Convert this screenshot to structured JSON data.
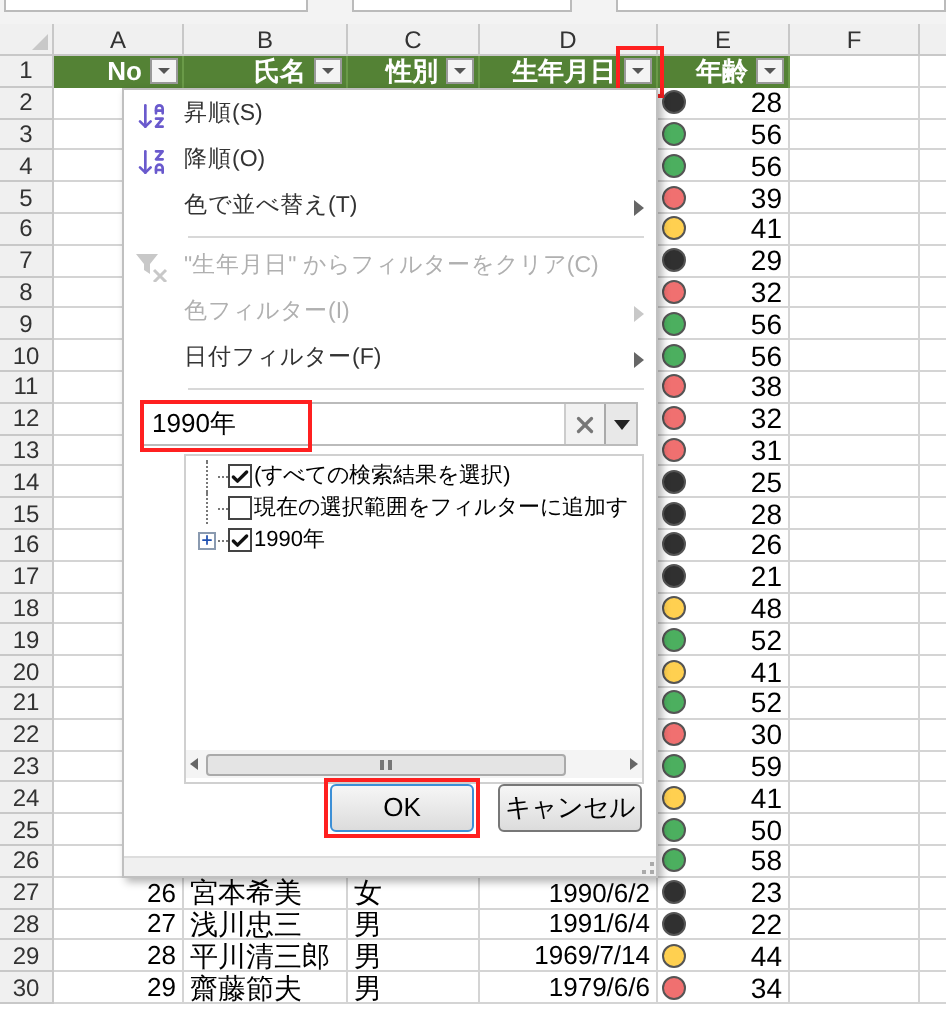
{
  "columns": [
    {
      "letter": "A",
      "header": "No",
      "filter_highlighted": false
    },
    {
      "letter": "B",
      "header": "氏名",
      "filter_highlighted": false
    },
    {
      "letter": "C",
      "header": "性別",
      "filter_highlighted": false
    },
    {
      "letter": "D",
      "header": "生年月日",
      "filter_highlighted": true
    },
    {
      "letter": "E",
      "header": "年齢",
      "filter_highlighted": false
    },
    {
      "letter": "F"
    }
  ],
  "header_row": "1",
  "rows": [
    {
      "row": "2",
      "age": "28",
      "color": "#303030"
    },
    {
      "row": "3",
      "age": "56",
      "color": "#4caf5f"
    },
    {
      "row": "4",
      "age": "56",
      "color": "#4caf5f"
    },
    {
      "row": "5",
      "age": "39",
      "color": "#f07070"
    },
    {
      "row": "6",
      "age": "41",
      "color": "#ffd050"
    },
    {
      "row": "7",
      "age": "29",
      "color": "#303030"
    },
    {
      "row": "8",
      "age": "32",
      "color": "#f07070"
    },
    {
      "row": "9",
      "age": "56",
      "color": "#4caf5f"
    },
    {
      "row": "10",
      "age": "56",
      "color": "#4caf5f"
    },
    {
      "row": "11",
      "age": "38",
      "color": "#f07070"
    },
    {
      "row": "12",
      "age": "32",
      "color": "#f07070"
    },
    {
      "row": "13",
      "age": "31",
      "color": "#f07070"
    },
    {
      "row": "14",
      "age": "25",
      "color": "#303030"
    },
    {
      "row": "15",
      "age": "28",
      "color": "#303030"
    },
    {
      "row": "16",
      "age": "26",
      "color": "#303030"
    },
    {
      "row": "17",
      "age": "21",
      "color": "#303030"
    },
    {
      "row": "18",
      "age": "48",
      "color": "#ffd050"
    },
    {
      "row": "19",
      "age": "52",
      "color": "#4caf5f"
    },
    {
      "row": "20",
      "age": "41",
      "color": "#ffd050"
    },
    {
      "row": "21",
      "age": "52",
      "color": "#4caf5f"
    },
    {
      "row": "22",
      "age": "30",
      "color": "#f07070"
    },
    {
      "row": "23",
      "age": "59",
      "color": "#4caf5f"
    },
    {
      "row": "24",
      "age": "41",
      "color": "#ffd050"
    },
    {
      "row": "25",
      "age": "50",
      "color": "#4caf5f"
    },
    {
      "row": "26",
      "age": "58",
      "color": "#4caf5f"
    },
    {
      "row": "27",
      "no": "26",
      "name": "宮本希美",
      "gender": "女",
      "birth": "1990/6/2",
      "age": "23",
      "color": "#303030"
    },
    {
      "row": "28",
      "no": "27",
      "name": "浅川忠三",
      "gender": "男",
      "birth": "1991/6/4",
      "age": "22",
      "color": "#303030"
    },
    {
      "row": "29",
      "no": "28",
      "name": "平川清三郎",
      "gender": "男",
      "birth": "1969/7/14",
      "age": "44",
      "color": "#ffd050"
    },
    {
      "row": "30",
      "no": "29",
      "name": "齋藤節夫",
      "gender": "男",
      "birth": "1979/6/6",
      "age": "34",
      "color": "#f07070"
    }
  ],
  "filter_menu": {
    "items": [
      {
        "kind": "ascending",
        "label": "昇順(S)",
        "disabled": false,
        "submenu": false
      },
      {
        "kind": "descending",
        "label": "降順(O)",
        "disabled": false,
        "submenu": false
      },
      {
        "kind": "plain",
        "label": "色で並べ替え(T)",
        "disabled": false,
        "submenu": true
      },
      {
        "kind": "separator"
      },
      {
        "kind": "clear",
        "label": "\"生年月日\" からフィルターをクリア(C)",
        "disabled": true,
        "submenu": false
      },
      {
        "kind": "plain",
        "label": "色フィルター(I)",
        "disabled": true,
        "submenu": true
      },
      {
        "kind": "plain",
        "label": "日付フィルター(F)",
        "disabled": false,
        "submenu": true
      },
      {
        "kind": "separator"
      }
    ],
    "search": {
      "value": "1990年",
      "highlighted": true
    },
    "list": [
      {
        "label": "(すべての検索結果を選択)",
        "checked": true,
        "expandable": false
      },
      {
        "label": "現在の選択範囲をフィルターに追加す",
        "checked": false,
        "expandable": false
      },
      {
        "label": "1990年",
        "checked": true,
        "expandable": true
      }
    ],
    "buttons": [
      {
        "label": "OK",
        "highlighted": true
      },
      {
        "label": "キャンセル",
        "highlighted": false
      }
    ]
  }
}
